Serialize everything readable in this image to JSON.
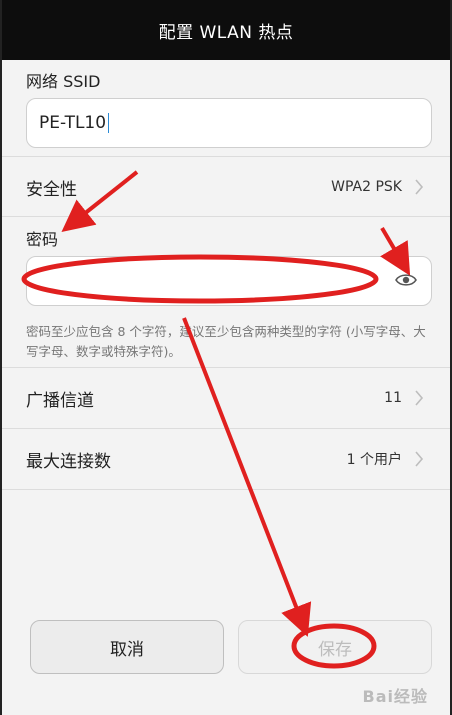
{
  "header": {
    "title": "配置 WLAN 热点"
  },
  "ssid": {
    "label": "网络 SSID",
    "value": "PE-TL10"
  },
  "security": {
    "label": "安全性",
    "value": "WPA2 PSK"
  },
  "password": {
    "label": "密码",
    "value": "",
    "hint": "密码至少应包含 8 个字符，建议至少包含两种类型的字符 (小写字母、大写字母、数字或特殊字符)。"
  },
  "channel": {
    "label": "广播信道",
    "value": "11"
  },
  "max_connections": {
    "label": "最大连接数",
    "value": "1 个用户"
  },
  "buttons": {
    "cancel_label": "取消",
    "save_label": "保存"
  },
  "icons": {
    "eye": "eye-icon",
    "chevron": "chevron-right-icon"
  },
  "colors": {
    "annotation_red": "#e0201f",
    "caret_blue": "#2b8bd6"
  },
  "watermark": "Bai经验"
}
